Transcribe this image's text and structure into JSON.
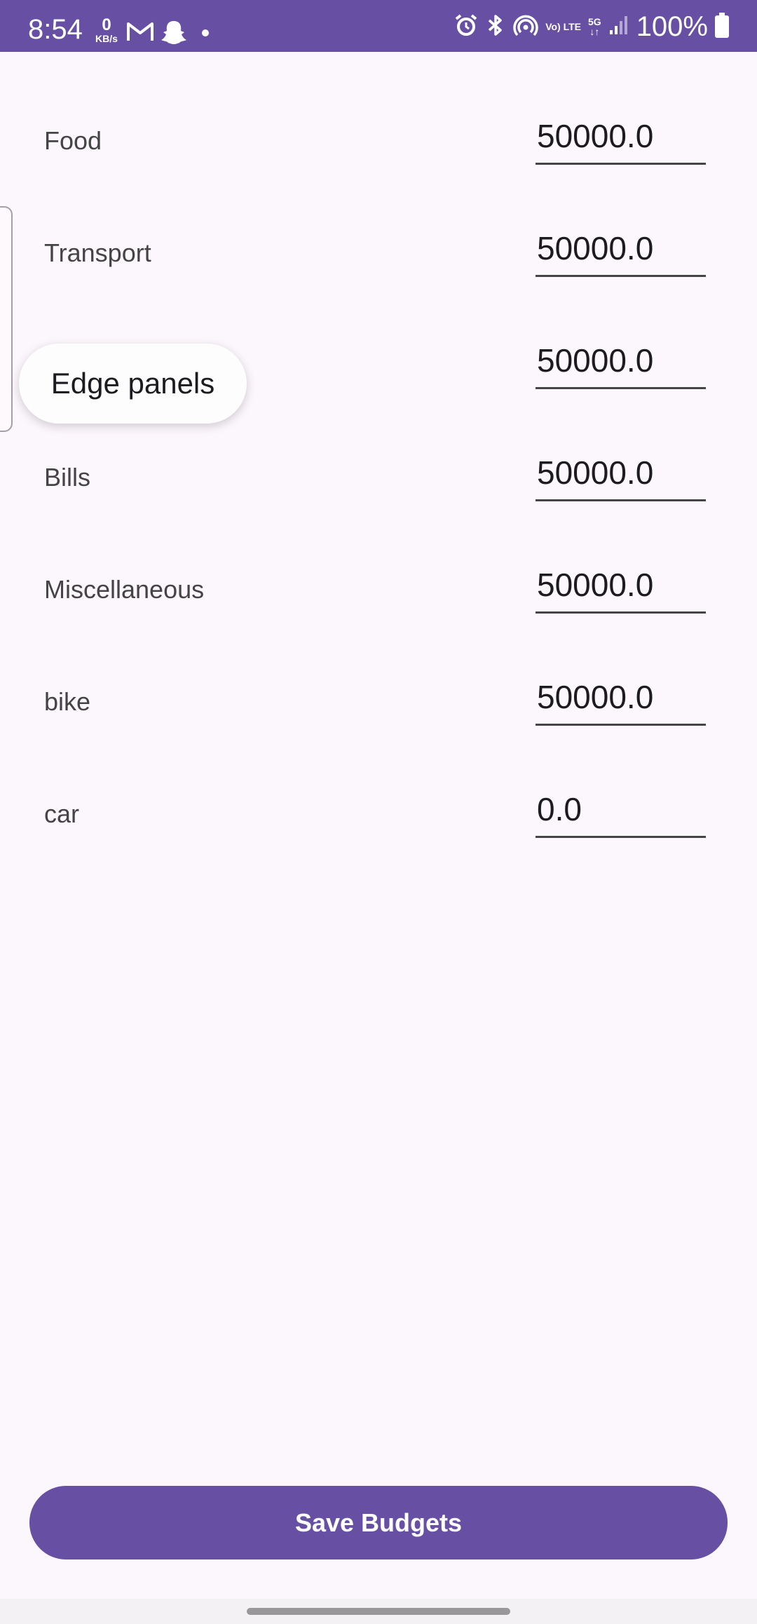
{
  "status_bar": {
    "time": "8:54",
    "net_speed_value": "0",
    "net_speed_unit": "KB/s",
    "volte": "Vo) LTE",
    "network_type": "5G",
    "battery": "100%",
    "icons": [
      "gmail-icon",
      "snapchat-icon",
      "alarm-icon",
      "bluetooth-icon",
      "hotspot-icon",
      "volte-icon",
      "5g-data-icon",
      "signal-icon",
      "battery-icon"
    ]
  },
  "budget_rows": [
    {
      "label": "Food",
      "value": "50000.0"
    },
    {
      "label": "Transport",
      "value": "50000.0"
    },
    {
      "label": "",
      "value": "50000.0"
    },
    {
      "label": "Bills",
      "value": "50000.0"
    },
    {
      "label": "Miscellaneous",
      "value": "50000.0"
    },
    {
      "label": "bike",
      "value": "50000.0"
    },
    {
      "label": "car",
      "value": "0.0"
    }
  ],
  "edge_panel": {
    "toast": "Edge panels"
  },
  "actions": {
    "save_label": "Save Budgets"
  },
  "colors": {
    "accent": "#6750A4",
    "background": "#FCF7FC"
  }
}
